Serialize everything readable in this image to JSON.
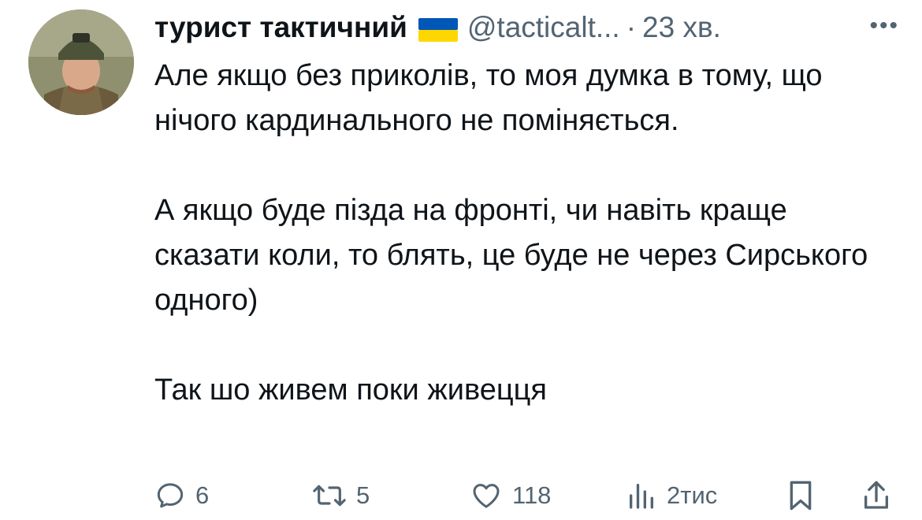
{
  "tweet": {
    "display_name": "турист тактичний",
    "flag_icon": "ukraine-flag-icon",
    "handle": "@tacticalt...",
    "separator": "·",
    "time": "23 хв.",
    "more_icon": "more-dots-icon",
    "more_label": "•••",
    "paragraphs": [
      "Але якщо без приколів, то моя думка в тому, що нічого кардинального не поміняється.",
      "А якщо буде пізда на фронті, чи навіть краще сказати коли, то блять, це буде не через Сирського одного)",
      "Так шо живем поки живецця"
    ]
  },
  "actions": {
    "reply": {
      "icon": "reply-icon",
      "count": "6"
    },
    "retweet": {
      "icon": "retweet-icon",
      "count": "5"
    },
    "like": {
      "icon": "heart-icon",
      "count": "118"
    },
    "views": {
      "icon": "views-icon",
      "count": "2тис"
    },
    "bookmark": {
      "icon": "bookmark-icon"
    },
    "share": {
      "icon": "share-icon"
    }
  },
  "colors": {
    "text": "#0f1419",
    "secondary": "#536471",
    "flag_blue": "#0057b7",
    "flag_yellow": "#ffd700"
  }
}
